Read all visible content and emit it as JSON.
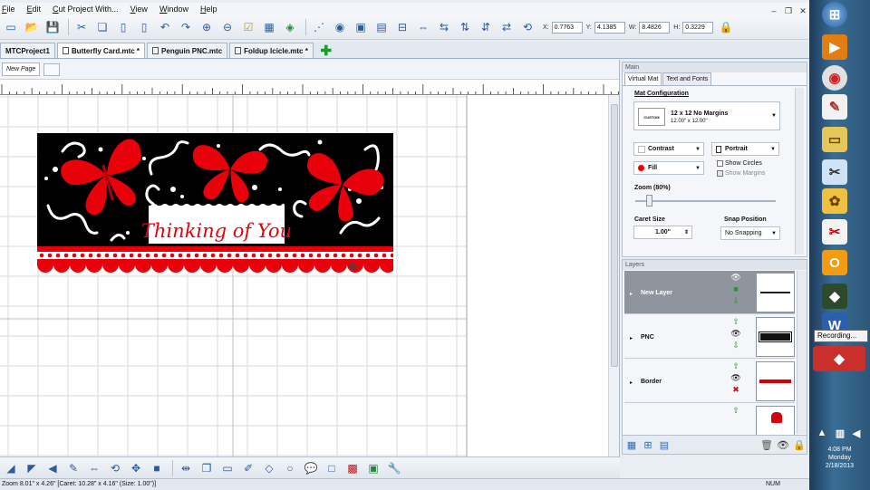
{
  "menu": [
    "File",
    "Edit",
    "Cut Project With...",
    "View",
    "Window",
    "Help"
  ],
  "coords": [
    {
      "label": "X:",
      "value": "0.7763"
    },
    {
      "label": "Y:",
      "value": "4.1385"
    },
    {
      "label": "W:",
      "value": "8.4826"
    },
    {
      "label": "H:",
      "value": "0.3229"
    }
  ],
  "tabs": [
    {
      "label": "MTCProject1"
    },
    {
      "label": "Butterfly Card.mtc *"
    },
    {
      "label": "Penguin PNC.mtc"
    },
    {
      "label": "Foldup Icicle.mtc *"
    }
  ],
  "page_tab": "New Page",
  "card": {
    "text": "Thinking of You"
  },
  "main_panel": {
    "title": "Main",
    "tabs": [
      "Virtual Mat",
      "Text and Fonts"
    ],
    "mat_config_heading": "Mat Configuration",
    "mat_thumb": "CUSTOM",
    "mat_name": "12 x 12 No Margins",
    "mat_size": "12.00\" x 12.00\"",
    "contrast": "Contrast",
    "orientation": "Portrait",
    "fill": "Fill",
    "show_circles": "Show Circles",
    "show_margins": "Show Margins",
    "zoom_label": "Zoom (80%)",
    "caret_size_label": "Caret Size",
    "caret_size_value": "1.00\"",
    "snap_label": "Snap Position",
    "snap_value": "No Snapping"
  },
  "layers_panel": {
    "title": "Layers",
    "layers": [
      {
        "name": "New Layer"
      },
      {
        "name": "PNC"
      },
      {
        "name": "Border"
      }
    ]
  },
  "status": {
    "left": "Zoom 8.01\" x 4.26\"  [Caret: 10.28\" x 4.16\"  (Size: 1.00\")]",
    "right": "NUM"
  },
  "taskbar": {
    "tooltip": "Recording...",
    "time": "4:08 PM",
    "day": "Monday",
    "date": "2/18/2013"
  },
  "colors": {
    "card_black": "#000000",
    "card_red": "#e8000b",
    "accent_blue": "#2c5d9a"
  }
}
